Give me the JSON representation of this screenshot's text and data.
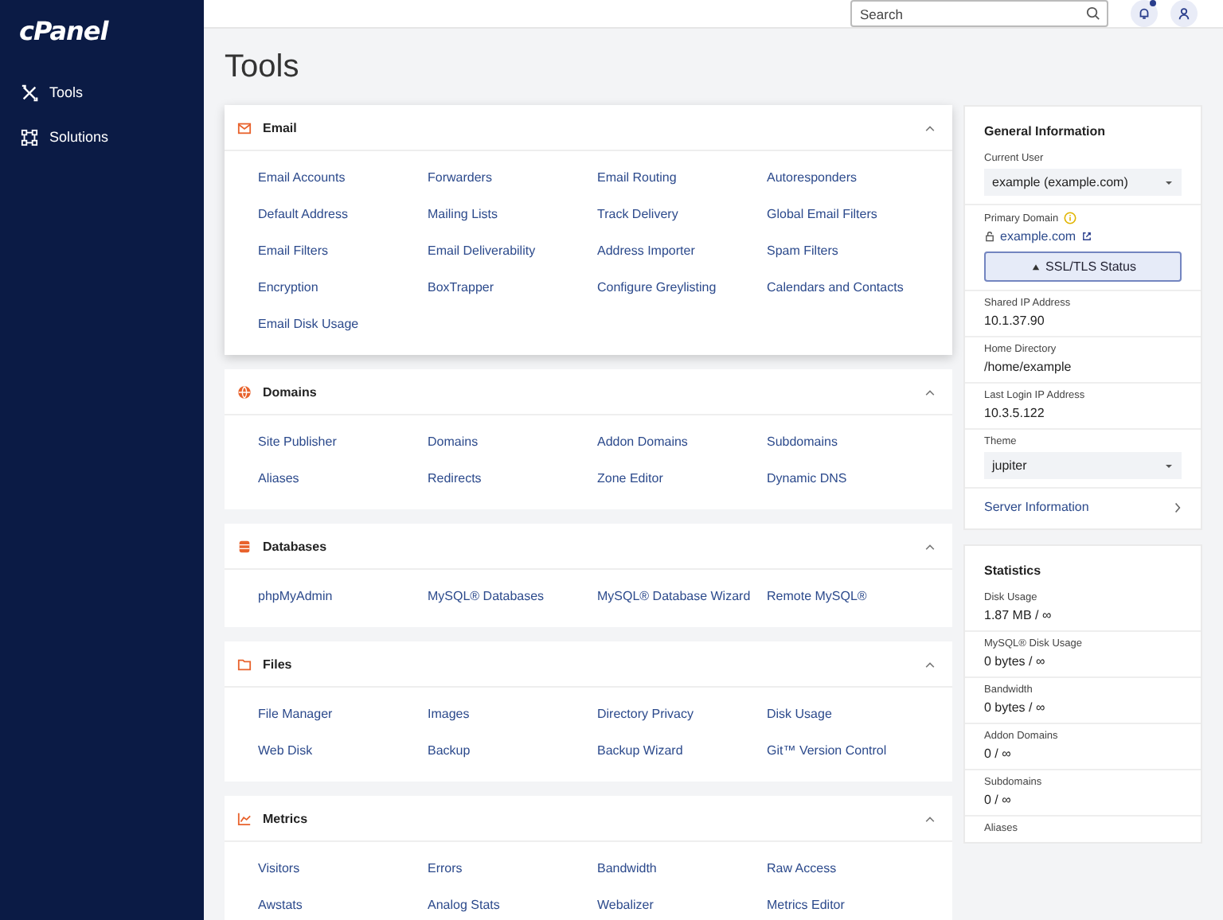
{
  "sidebar": {
    "logo": "cPanel",
    "items": [
      {
        "label": "Tools"
      },
      {
        "label": "Solutions"
      }
    ]
  },
  "header": {
    "search": {
      "placeholder": "Search"
    },
    "has_notifications": true
  },
  "page_title": "Tools",
  "sections": [
    {
      "title": "Email",
      "expanded": true,
      "items": [
        "Email Accounts",
        "Forwarders",
        "Email Routing",
        "Autoresponders",
        "Default Address",
        "Mailing Lists",
        "Track Delivery",
        "Global Email Filters",
        "Email Filters",
        "Email Deliverability",
        "Address Importer",
        "Spam Filters",
        "Encryption",
        "BoxTrapper",
        "Configure Greylisting",
        "Calendars and Contacts",
        "Email Disk Usage"
      ]
    },
    {
      "title": "Domains",
      "expanded": true,
      "items": [
        "Site Publisher",
        "Domains",
        "Addon Domains",
        "Subdomains",
        "Aliases",
        "Redirects",
        "Zone Editor",
        "Dynamic DNS"
      ]
    },
    {
      "title": "Databases",
      "expanded": true,
      "items": [
        "phpMyAdmin",
        "MySQL® Databases",
        "MySQL® Database Wizard",
        "Remote MySQL®"
      ]
    },
    {
      "title": "Files",
      "expanded": true,
      "items": [
        "File Manager",
        "Images",
        "Directory Privacy",
        "Disk Usage",
        "Web Disk",
        "Backup",
        "Backup Wizard",
        "Git™ Version Control"
      ]
    },
    {
      "title": "Metrics",
      "expanded": true,
      "items": [
        "Visitors",
        "Errors",
        "Bandwidth",
        "Raw Access",
        "Awstats",
        "Analog Stats",
        "Webalizer",
        "Metrics Editor"
      ]
    }
  ],
  "general_information": {
    "title": "General Information",
    "fields": [
      {
        "kind": "select",
        "label": "Current User",
        "value": "example (example.com)"
      },
      {
        "kind": "domain",
        "label": "Primary Domain",
        "value": "example.com",
        "button": "SSL/TLS Status"
      },
      {
        "kind": "text",
        "label": "Shared IP Address",
        "value": "10.1.37.90"
      },
      {
        "kind": "text",
        "label": "Home Directory",
        "value": "/home/example"
      },
      {
        "kind": "text",
        "label": "Last Login IP Address",
        "value": "10.3.5.122"
      },
      {
        "kind": "select",
        "label": "Theme",
        "value": "jupiter"
      },
      {
        "kind": "nav",
        "value": "Server Information"
      }
    ]
  },
  "statistics": {
    "title": "Statistics",
    "items": [
      {
        "label": "Disk Usage",
        "value": "1.87 MB / ∞"
      },
      {
        "label": "MySQL® Disk Usage",
        "value": "0 bytes / ∞"
      },
      {
        "label": "Bandwidth",
        "value": "0 bytes / ∞"
      },
      {
        "label": "Addon Domains",
        "value": "0 / ∞"
      },
      {
        "label": "Subdomains",
        "value": "0 / ∞"
      },
      {
        "label": "Aliases"
      }
    ]
  }
}
